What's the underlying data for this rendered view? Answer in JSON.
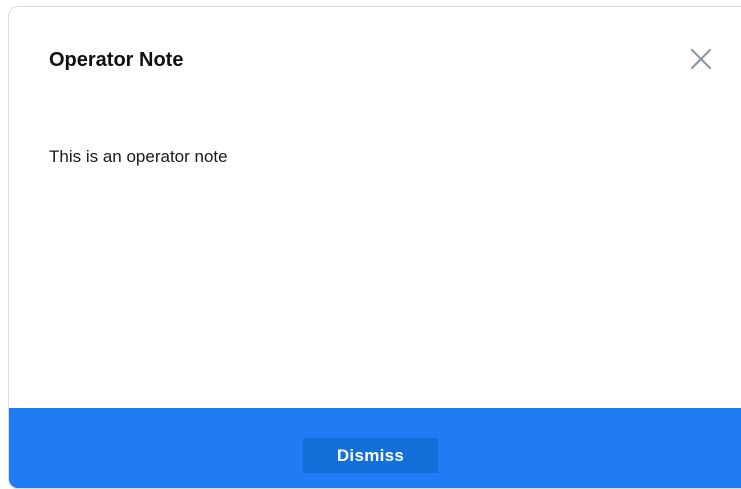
{
  "modal": {
    "title": "Operator Note",
    "body_text": "This is an operator note",
    "close_icon": "close-icon",
    "dismiss_label": "Dismiss"
  },
  "colors": {
    "footer_background": "#1f7cf5",
    "button_background": "#146fd8",
    "close_icon": "#8e96a0"
  }
}
